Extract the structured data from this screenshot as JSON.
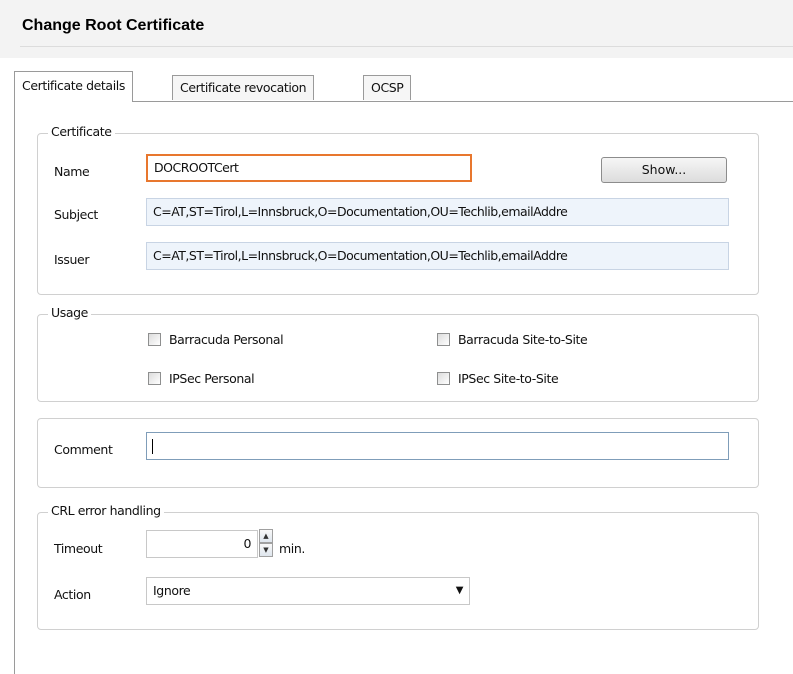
{
  "window": {
    "title": "Change Root Certificate"
  },
  "tabs": [
    {
      "label": "Certificate details",
      "active": true
    },
    {
      "label": "Certificate revocation",
      "active": false
    },
    {
      "label": "OCSP",
      "active": false
    }
  ],
  "certificate": {
    "legend": "Certificate",
    "name_label": "Name",
    "name_value": "DOCROOTCert",
    "show_button": "Show...",
    "subject_label": "Subject",
    "subject_value": "C=AT,ST=Tirol,L=Innsbruck,O=Documentation,OU=Techlib,emailAddre",
    "issuer_label": "Issuer",
    "issuer_value": "C=AT,ST=Tirol,L=Innsbruck,O=Documentation,OU=Techlib,emailAddre"
  },
  "usage": {
    "legend": "Usage",
    "options": [
      {
        "label": "Barracuda Personal",
        "checked": false
      },
      {
        "label": "Barracuda Site-to-Site",
        "checked": false
      },
      {
        "label": "IPSec Personal",
        "checked": false
      },
      {
        "label": "IPSec Site-to-Site",
        "checked": false
      }
    ]
  },
  "comment": {
    "label": "Comment",
    "value": ""
  },
  "crl": {
    "legend": "CRL error handling",
    "timeout_label": "Timeout",
    "timeout_value": "0",
    "timeout_unit": "min.",
    "action_label": "Action",
    "action_value": "Ignore"
  },
  "colors": {
    "focus_border": "#e8772e",
    "field_bg": "#eef4fb"
  }
}
